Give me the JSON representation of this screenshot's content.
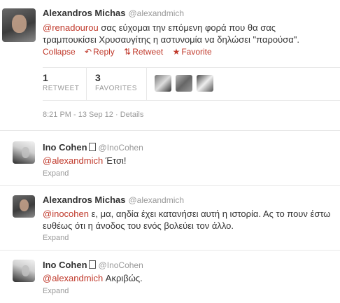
{
  "main_tweet": {
    "author_name": "Alexandros Michas",
    "author_handle": "@alexandmich",
    "mention": "@renadourou",
    "text": " σας εύχομαι την επόμενη φορά που θα σας τραμπουκίσει Χρυσαυγίτης η αστυνομία να δηλώσει \"παρούσα\".",
    "actions": {
      "collapse": "Collapse",
      "reply": "Reply",
      "retweet": "Retweet",
      "favorite": "Favorite"
    },
    "stats": {
      "retweets": "1",
      "retweets_label": "RETWEET",
      "favorites": "3",
      "favorites_label": "FAVORITES"
    },
    "timestamp": "8:21 PM - 13 Sep 12",
    "details": "Details"
  },
  "replies": [
    {
      "author_name": "Ino Cohen",
      "author_handle": "@InoCohen",
      "mention": "@alexandmich",
      "text": " Έτσι!",
      "expand": "Expand"
    },
    {
      "author_name": "Alexandros Michas",
      "author_handle": "@alexandmich",
      "mention": "@inocohen",
      "text": " ε, μα, αηδία έχει κατανήσει αυτή η ιστορία. Ας το πουν έστω ευθέως ότι η άνοδος του ενός βολεύει τον άλλο.",
      "expand": "Expand"
    },
    {
      "author_name": "Ino Cohen",
      "author_handle": "@InoCohen",
      "mention": "@alexandmich",
      "text": " Ακριβώς.",
      "expand": "Expand"
    }
  ],
  "colors": {
    "link": "#c0392b",
    "muted": "#999999",
    "text": "#333333",
    "separator": "#e8e8e8"
  },
  "icons": {
    "reply": "reply-arrow-icon",
    "retweet": "retweet-icon",
    "favorite": "star-icon"
  }
}
